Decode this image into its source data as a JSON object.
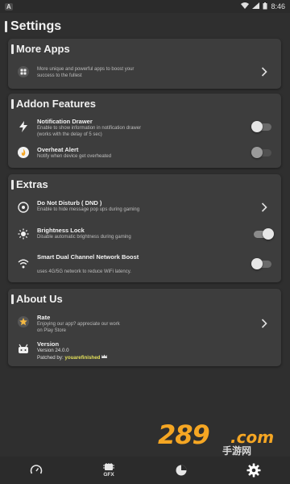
{
  "status_bar": {
    "app_badge": "A",
    "time": "8:46"
  },
  "page": {
    "title": "Settings"
  },
  "sections": {
    "more_apps": {
      "title": "More Apps",
      "row": {
        "description": "More unique and powerful apps to boost your success to the fullest"
      }
    },
    "addon": {
      "title": "Addon Features",
      "notification": {
        "title": "Notification Drawer",
        "description": "Enable to show information in notification drawer (works with the delay of 5 sec)",
        "state": "off"
      },
      "overheat": {
        "title": "Overheat Alert",
        "description": "Notify when device get overheated",
        "state": "off-disabled"
      }
    },
    "extras": {
      "title": "Extras",
      "dnd": {
        "title": "Do Not Disturb ( DND )",
        "description": "Enable to hide message pop ups during gaming"
      },
      "brightness": {
        "title": "Brightness Lock",
        "description": "Disable automatic brightness during gaming",
        "state": "on"
      },
      "network": {
        "title": "Smart Dual Channel Network Boost",
        "description": "uses 4G/5G network to reduce WiFi latency.",
        "state": "off"
      }
    },
    "about": {
      "title": "About Us",
      "rate": {
        "title": "Rate",
        "description": "Enjoying our app? appreciate our work on Play Store"
      },
      "version": {
        "title": "Version",
        "value": "Version 24.0.0",
        "patched_prefix": "Patched by:",
        "patched_name": "youarefinished"
      }
    }
  },
  "watermark": {
    "number": "289",
    "suffix": ".com",
    "chinese": "手游网"
  },
  "bottom_nav": {
    "gfx_label": "GFX"
  },
  "colors": {
    "background": "#2f2f2f",
    "card": "#3d3d3d",
    "accent_star": "#f5b942",
    "patched_name": "#e3e05a",
    "watermark": "#f5a623"
  }
}
